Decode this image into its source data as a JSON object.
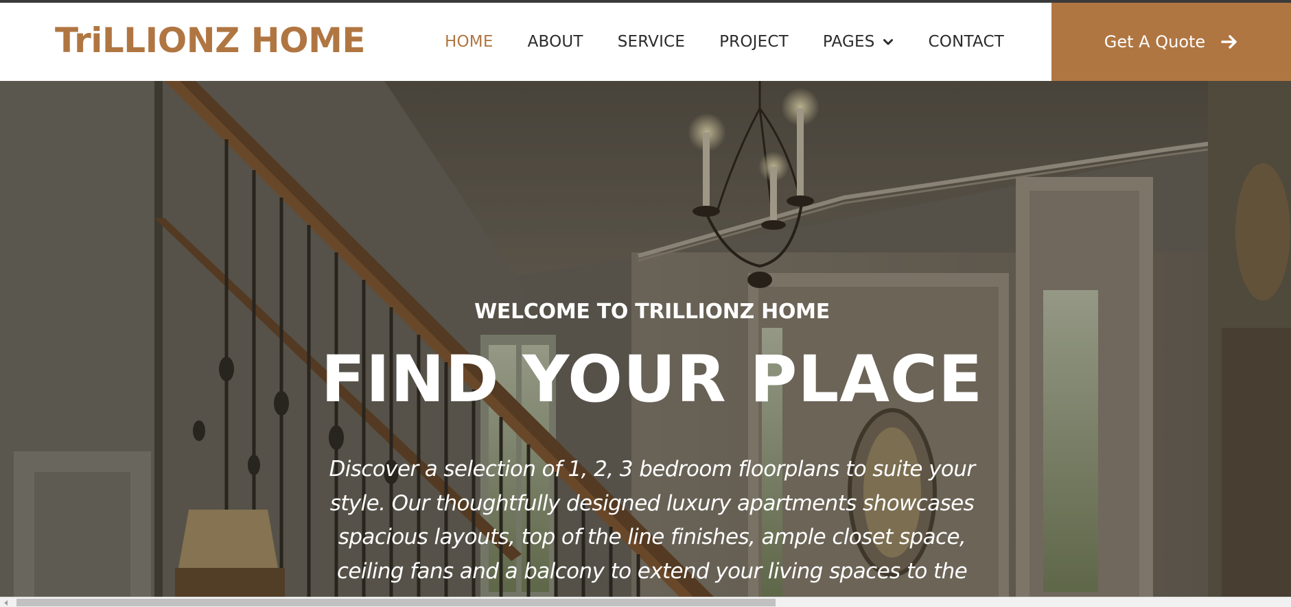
{
  "brand": {
    "name": "TriLLIONZ HOME",
    "color": "#b07642"
  },
  "nav": {
    "items": [
      {
        "label": "HOME",
        "active": true
      },
      {
        "label": "ABOUT",
        "active": false
      },
      {
        "label": "SERVICE",
        "active": false
      },
      {
        "label": "PROJECT",
        "active": false
      },
      {
        "label": "PAGES",
        "active": false,
        "icon": "chevron-down-icon"
      },
      {
        "label": "CONTACT",
        "active": false
      }
    ],
    "cta": {
      "label": "Get A Quote",
      "icon": "arrow-right-icon",
      "color": "#b07642"
    }
  },
  "hero": {
    "eyebrow": "WELCOME TO TRILLIONZ HOME",
    "title": "FIND YOUR PLACE",
    "description": "Discover a selection of 1, 2, 3 bedroom floorplans to suite your style. Our thoughtfully designed luxury apartments showcases spacious layouts, top of the line finishes, ample closet space, ceiling fans and a balcony to extend your living spaces to the"
  }
}
